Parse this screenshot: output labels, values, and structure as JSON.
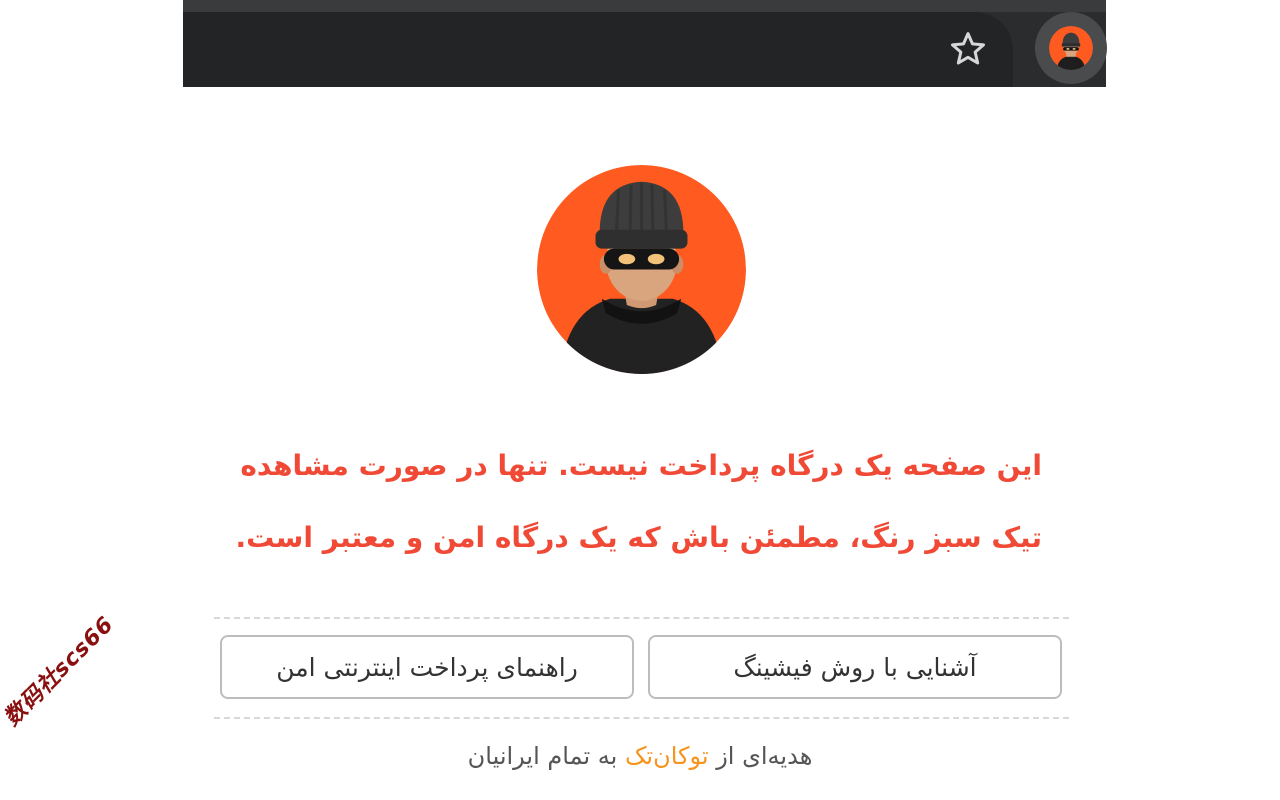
{
  "toolbar": {
    "bookmark_icon": "star-outline-icon",
    "profile_icon": "thief-avatar-icon"
  },
  "colors": {
    "accent_orange": "#ff5a1f",
    "warning_red": "#f04a37",
    "brand_orange": "#f7941d"
  },
  "main": {
    "warning_line1": "این صفحه یک درگاه پرداخت نیست. تنها در صورت مشاهده",
    "warning_line2": "تیک سبز رنگ، مطمئن باش که یک درگاه امن و معتبر است.",
    "button_phishing": "آشنایی با روش فیشینگ",
    "button_guide": "راهنمای پرداخت اینترنتی امن"
  },
  "footer": {
    "prefix": "هدیه‌ای از",
    "brand": "توکان‌تک",
    "suffix": "به تمام ایرانیان"
  },
  "watermark": "数码社scs66"
}
